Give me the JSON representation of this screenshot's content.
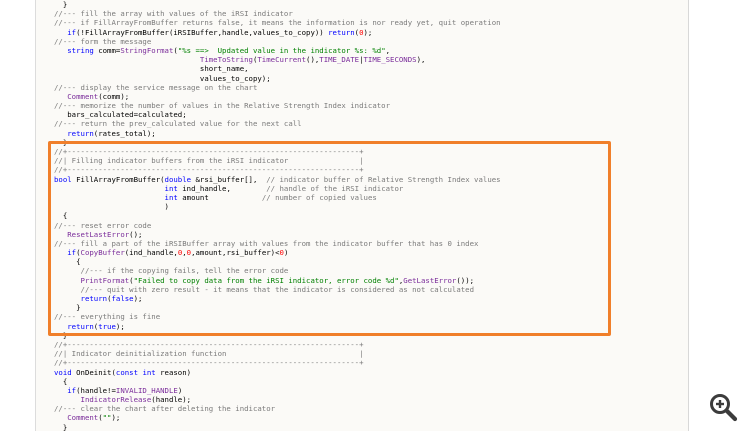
{
  "code": {
    "lines": [
      [
        {
          "t": "  }",
          "k": "p"
        }
      ],
      [
        {
          "t": "//--- fill the array with values of the iRSI indicator",
          "k": "c"
        }
      ],
      [
        {
          "t": "//--- if FillArrayFromBuffer returns false, it means the information is nor ready yet, quit operation",
          "k": "c"
        }
      ],
      [
        {
          "t": "   ",
          "k": "p"
        },
        {
          "t": "if",
          "k": "k"
        },
        {
          "t": "(!FillArrayFromBuffer(iRSIBuffer,handle,values_to_copy)) ",
          "k": "p"
        },
        {
          "t": "return",
          "k": "k"
        },
        {
          "t": "(",
          "k": "p"
        },
        {
          "t": "0",
          "k": "n"
        },
        {
          "t": ");",
          "k": "p"
        }
      ],
      [
        {
          "t": "//--- form the message",
          "k": "c"
        }
      ],
      [
        {
          "t": "   ",
          "k": "p"
        },
        {
          "t": "string",
          "k": "k"
        },
        {
          "t": " comm=",
          "k": "p"
        },
        {
          "t": "StringFormat",
          "k": "f"
        },
        {
          "t": "(",
          "k": "p"
        },
        {
          "t": "\"%s ==>  Updated value in the indicator %s: %d\"",
          "k": "s"
        },
        {
          "t": ",",
          "k": "p"
        }
      ],
      [
        {
          "t": "                                 ",
          "k": "p"
        },
        {
          "t": "TimeToString",
          "k": "f"
        },
        {
          "t": "(",
          "k": "p"
        },
        {
          "t": "TimeCurrent",
          "k": "f"
        },
        {
          "t": "(),",
          "k": "p"
        },
        {
          "t": "TIME_DATE",
          "k": "f"
        },
        {
          "t": "|",
          "k": "p"
        },
        {
          "t": "TIME_SECONDS",
          "k": "f"
        },
        {
          "t": "),",
          "k": "p"
        }
      ],
      [
        {
          "t": "                                 short_name,",
          "k": "p"
        }
      ],
      [
        {
          "t": "                                 values_to_copy);",
          "k": "p"
        }
      ],
      [
        {
          "t": "//--- display the service message on the chart",
          "k": "c"
        }
      ],
      [
        {
          "t": "   ",
          "k": "p"
        },
        {
          "t": "Comment",
          "k": "f"
        },
        {
          "t": "(comm);",
          "k": "p"
        }
      ],
      [
        {
          "t": "//--- memorize the number of values in the Relative Strength Index indicator",
          "k": "c"
        }
      ],
      [
        {
          "t": "   bars_calculated=calculated;",
          "k": "p"
        }
      ],
      [
        {
          "t": "//--- return the prev_calculated value for the next call",
          "k": "c"
        }
      ],
      [
        {
          "t": "   ",
          "k": "p"
        },
        {
          "t": "return",
          "k": "k"
        },
        {
          "t": "(rates_total);",
          "k": "p"
        }
      ],
      [
        {
          "t": "  }",
          "k": "p"
        }
      ],
      [
        {
          "t": "//+------------------------------------------------------------------+",
          "k": "c"
        }
      ],
      [
        {
          "t": "//| Filling indicator buffers from the iRSI indicator                |",
          "k": "c"
        }
      ],
      [
        {
          "t": "//+------------------------------------------------------------------+",
          "k": "c"
        }
      ],
      [
        {
          "t": "bool",
          "k": "k"
        },
        {
          "t": " FillArrayFromBuffer(",
          "k": "p"
        },
        {
          "t": "double",
          "k": "k"
        },
        {
          "t": " &rsi_buffer[],  ",
          "k": "p"
        },
        {
          "t": "// indicator buffer of Relative Strength Index values",
          "k": "c"
        }
      ],
      [
        {
          "t": "                         ",
          "k": "p"
        },
        {
          "t": "int",
          "k": "k"
        },
        {
          "t": " ind_handle,        ",
          "k": "p"
        },
        {
          "t": "// handle of the iRSI indicator",
          "k": "c"
        }
      ],
      [
        {
          "t": "                         ",
          "k": "p"
        },
        {
          "t": "int",
          "k": "k"
        },
        {
          "t": " amount            ",
          "k": "p"
        },
        {
          "t": "// number of copied values",
          "k": "c"
        }
      ],
      [
        {
          "t": "                         )",
          "k": "p"
        }
      ],
      [
        {
          "t": "  {",
          "k": "p"
        }
      ],
      [
        {
          "t": "//--- reset error code",
          "k": "c"
        }
      ],
      [
        {
          "t": "   ",
          "k": "p"
        },
        {
          "t": "ResetLastError",
          "k": "f"
        },
        {
          "t": "();",
          "k": "p"
        }
      ],
      [
        {
          "t": "//--- fill a part of the iRSIBuffer array with values from the indicator buffer that has 0 index",
          "k": "c"
        }
      ],
      [
        {
          "t": "   ",
          "k": "p"
        },
        {
          "t": "if",
          "k": "k"
        },
        {
          "t": "(",
          "k": "p"
        },
        {
          "t": "CopyBuffer",
          "k": "f"
        },
        {
          "t": "(ind_handle,",
          "k": "p"
        },
        {
          "t": "0",
          "k": "n"
        },
        {
          "t": ",",
          "k": "p"
        },
        {
          "t": "0",
          "k": "n"
        },
        {
          "t": ",amount,rsi_buffer)<",
          "k": "p"
        },
        {
          "t": "0",
          "k": "n"
        },
        {
          "t": ")",
          "k": "p"
        }
      ],
      [
        {
          "t": "     {",
          "k": "p"
        }
      ],
      [
        {
          "t": "      ",
          "k": "p"
        },
        {
          "t": "//--- if the copying fails, tell the error code",
          "k": "c"
        }
      ],
      [
        {
          "t": "      ",
          "k": "p"
        },
        {
          "t": "PrintFormat",
          "k": "f"
        },
        {
          "t": "(",
          "k": "p"
        },
        {
          "t": "\"Failed to copy data from the iRSI indicator, error code %d\"",
          "k": "s"
        },
        {
          "t": ",",
          "k": "p"
        },
        {
          "t": "GetLastError",
          "k": "f"
        },
        {
          "t": "());",
          "k": "p"
        }
      ],
      [
        {
          "t": "      ",
          "k": "p"
        },
        {
          "t": "//--- quit with zero result - it means that the indicator is considered as not calculated",
          "k": "c"
        }
      ],
      [
        {
          "t": "      ",
          "k": "p"
        },
        {
          "t": "return",
          "k": "k"
        },
        {
          "t": "(",
          "k": "p"
        },
        {
          "t": "false",
          "k": "k"
        },
        {
          "t": ");",
          "k": "p"
        }
      ],
      [
        {
          "t": "     }",
          "k": "p"
        }
      ],
      [
        {
          "t": "//--- everything is fine",
          "k": "c"
        }
      ],
      [
        {
          "t": "   ",
          "k": "p"
        },
        {
          "t": "return",
          "k": "k"
        },
        {
          "t": "(",
          "k": "p"
        },
        {
          "t": "true",
          "k": "k"
        },
        {
          "t": ");",
          "k": "p"
        }
      ],
      [
        {
          "t": "  }",
          "k": "p"
        }
      ],
      [
        {
          "t": "//+------------------------------------------------------------------+",
          "k": "c"
        }
      ],
      [
        {
          "t": "//| Indicator deinitialization function                              |",
          "k": "c"
        }
      ],
      [
        {
          "t": "//+------------------------------------------------------------------+",
          "k": "c"
        }
      ],
      [
        {
          "t": "void",
          "k": "k"
        },
        {
          "t": " OnDeinit(",
          "k": "p"
        },
        {
          "t": "const",
          "k": "k"
        },
        {
          "t": " ",
          "k": "p"
        },
        {
          "t": "int",
          "k": "k"
        },
        {
          "t": " reason)",
          "k": "p"
        }
      ],
      [
        {
          "t": "  {",
          "k": "p"
        }
      ],
      [
        {
          "t": "   ",
          "k": "p"
        },
        {
          "t": "if",
          "k": "k"
        },
        {
          "t": "(handle!=",
          "k": "p"
        },
        {
          "t": "INVALID_HANDLE",
          "k": "f"
        },
        {
          "t": ")",
          "k": "p"
        }
      ],
      [
        {
          "t": "      ",
          "k": "p"
        },
        {
          "t": "IndicatorRelease",
          "k": "f"
        },
        {
          "t": "(handle);",
          "k": "p"
        }
      ],
      [
        {
          "t": "//--- clear the chart after deleting the indicator",
          "k": "c"
        }
      ],
      [
        {
          "t": "   ",
          "k": "p"
        },
        {
          "t": "Comment",
          "k": "f"
        },
        {
          "t": "(",
          "k": "p"
        },
        {
          "t": "\"\"",
          "k": "s"
        },
        {
          "t": ");",
          "k": "p"
        }
      ],
      [
        {
          "t": "  }",
          "k": "p"
        }
      ]
    ]
  },
  "highlight": {
    "color": "#f07f2a"
  },
  "zoom_button": {
    "icon": "zoom-in-icon"
  },
  "colors": {
    "comment": "#7a7a7a",
    "keyword": "#0000ff",
    "function": "#7a2c9a",
    "string": "#008000",
    "number": "#ff0000"
  }
}
